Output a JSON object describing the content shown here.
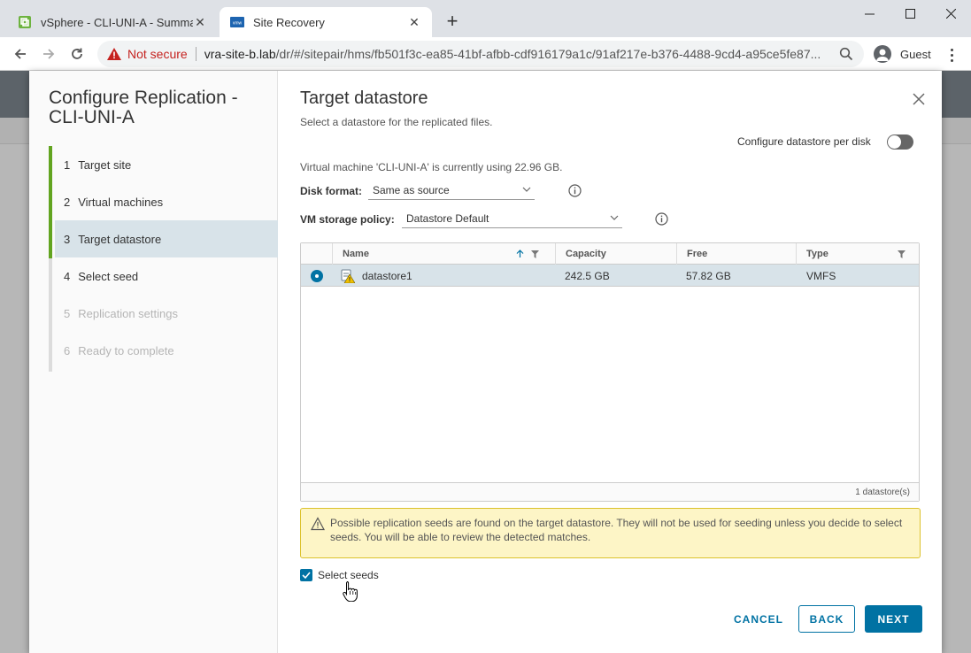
{
  "browser": {
    "tabs": [
      {
        "title": "vSphere - CLI-UNI-A - Summary",
        "active": false
      },
      {
        "title": "Site Recovery",
        "active": true
      }
    ],
    "new_tab": "+",
    "omnibox": {
      "security_label": "Not secure",
      "url_host": "vra-site-b.lab",
      "url_path": "/dr/#/sitepair/hms/fb501f3c-ea85-41bf-afbb-cdf916179a1c/91af217e-b376-4488-9cd4-a95ce5fe87..."
    },
    "profile_label": "Guest"
  },
  "wizard": {
    "title": "Configure Replication - CLI-UNI-A",
    "steps": [
      {
        "num": "1",
        "label": "Target site",
        "state": "done"
      },
      {
        "num": "2",
        "label": "Virtual machines",
        "state": "done"
      },
      {
        "num": "3",
        "label": "Target datastore",
        "state": "current"
      },
      {
        "num": "4",
        "label": "Select seed",
        "state": "enabled"
      },
      {
        "num": "5",
        "label": "Replication settings",
        "state": "disabled"
      },
      {
        "num": "6",
        "label": "Ready to complete",
        "state": "disabled"
      }
    ]
  },
  "content": {
    "title": "Target datastore",
    "subtitle": "Select a datastore for the replicated files.",
    "toggle_label": "Configure datastore per disk",
    "toggle_on": false,
    "vm_info": "Virtual machine 'CLI-UNI-A' is currently using 22.96 GB.",
    "disk_format_label": "Disk format:",
    "disk_format_value": "Same as source",
    "storage_policy_label": "VM storage policy:",
    "storage_policy_value": "Datastore Default",
    "grid": {
      "columns": [
        "Name",
        "Capacity",
        "Free",
        "Type"
      ],
      "rows": [
        {
          "name": "datastore1",
          "capacity": "242.5 GB",
          "free": "57.82 GB",
          "type": "VMFS",
          "selected": true
        }
      ],
      "footer": "1 datastore(s)"
    },
    "alert_text": "Possible replication seeds are found on the target datastore. They will not be used for seeding unless you decide to select seeds. You will be able to review the detected matches.",
    "select_seeds_label": "Select seeds",
    "select_seeds_checked": true,
    "buttons": {
      "cancel": "CANCEL",
      "back": "BACK",
      "next": "NEXT"
    }
  },
  "colors": {
    "primary": "#0072a3",
    "progress_green": "#62a420",
    "selected_row": "#d8e3e9",
    "warning_bg": "#fdf5c6",
    "not_secure_red": "#c5221f"
  }
}
